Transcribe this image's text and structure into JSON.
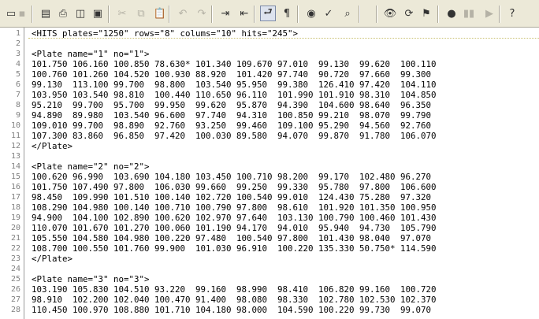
{
  "toolbar": {
    "buttons": [
      {
        "icon": "new-file-icon",
        "glyph": "▭",
        "disabled": false
      },
      {
        "icon": "save-icon",
        "glyph": "▪",
        "disabled": true
      },
      {
        "icon": "file-list-icon",
        "glyph": "▤",
        "disabled": false
      },
      {
        "icon": "print-icon",
        "glyph": "⎙",
        "disabled": false
      },
      {
        "icon": "print-preview-icon",
        "glyph": "◫",
        "disabled": false
      },
      {
        "icon": "page-setup-icon",
        "glyph": "▣",
        "disabled": false
      },
      {
        "icon": "cut-icon",
        "glyph": "✂",
        "disabled": true
      },
      {
        "icon": "copy-icon",
        "glyph": "⧉",
        "disabled": true
      },
      {
        "icon": "paste-icon",
        "glyph": "📋",
        "disabled": true
      },
      {
        "icon": "undo-icon",
        "glyph": "↶",
        "disabled": true
      },
      {
        "icon": "redo-icon",
        "glyph": "↷",
        "disabled": true
      },
      {
        "icon": "indent-icon",
        "glyph": "⇥",
        "disabled": false
      },
      {
        "icon": "outdent-icon",
        "glyph": "⇤",
        "disabled": false
      },
      {
        "icon": "word-wrap-icon",
        "glyph": "⮐",
        "disabled": false
      },
      {
        "icon": "pilcrow-icon",
        "glyph": "¶",
        "disabled": false
      },
      {
        "icon": "web-browser-icon",
        "glyph": "◉",
        "disabled": false
      },
      {
        "icon": "spell-check-icon",
        "glyph": "✓",
        "disabled": false
      },
      {
        "icon": "find-in-files-icon",
        "glyph": "⌕",
        "disabled": false
      },
      {
        "icon": "find-icon",
        "glyph": "👁",
        "disabled": false
      },
      {
        "icon": "replace-icon",
        "glyph": "⟳",
        "disabled": false
      },
      {
        "icon": "goto-icon",
        "glyph": "⚑",
        "disabled": false
      },
      {
        "icon": "toggle-bookmark-icon",
        "glyph": "●",
        "disabled": false
      },
      {
        "icon": "bookmark-navigation-icon",
        "glyph": "▮▮",
        "disabled": true
      },
      {
        "icon": "next-bookmark-icon",
        "glyph": "▶",
        "disabled": true
      },
      {
        "icon": "context-help-icon",
        "glyph": "?",
        "disabled": false
      }
    ]
  },
  "editor": {
    "lines": [
      {
        "n": "1",
        "text": "<HITS plates=\"1250\" rows=\"8\" colums=\"10\" hits=\"245\">"
      },
      {
        "n": "2",
        "text": ""
      },
      {
        "n": "3",
        "text": "<Plate name=\"1\" no=\"1\">"
      },
      {
        "n": "4",
        "text": "101.750 106.160 100.850 78.630* 101.340 109.670 97.010  99.130  99.620  100.110"
      },
      {
        "n": "5",
        "text": "100.760 101.260 104.520 100.930 88.920  101.420 97.740  90.720  97.660  99.300"
      },
      {
        "n": "6",
        "text": "99.130  113.100 99.700  98.800  103.540 95.950  99.380  126.410 97.420  104.110"
      },
      {
        "n": "7",
        "text": "103.950 103.540 98.810  100.440 110.650 96.110  101.990 101.910 98.310  104.850"
      },
      {
        "n": "8",
        "text": "95.210  99.700  95.700  99.950  99.620  95.870  94.390  104.600 98.640  96.350"
      },
      {
        "n": "9",
        "text": "94.890  89.980  103.540 96.600  97.740  94.310  100.850 99.210  98.070  99.790"
      },
      {
        "n": "10",
        "text": "109.010 99.700  98.890  92.760  93.250  99.460  109.100 95.290  94.560  92.760"
      },
      {
        "n": "11",
        "text": "107.300 83.860  96.850  97.420  100.030 89.580  94.070  99.870  91.780  106.070"
      },
      {
        "n": "12",
        "text": "</Plate>"
      },
      {
        "n": "13",
        "text": ""
      },
      {
        "n": "14",
        "text": "<Plate name=\"2\" no=\"2\">"
      },
      {
        "n": "15",
        "text": "100.620 96.990  103.690 104.180 103.450 100.710 98.200  99.170  102.480 96.270"
      },
      {
        "n": "16",
        "text": "101.750 107.490 97.800  106.030 99.660  99.250  99.330  95.780  97.800  106.600"
      },
      {
        "n": "17",
        "text": "98.450  109.990 101.510 100.140 102.720 100.540 99.010  124.430 75.280  97.320"
      },
      {
        "n": "18",
        "text": "108.290 104.980 100.140 100.710 100.790 97.800  98.610  101.920 101.350 100.950"
      },
      {
        "n": "19",
        "text": "94.900  104.100 102.890 100.620 102.970 97.640  103.130 100.790 100.460 101.430"
      },
      {
        "n": "20",
        "text": "110.070 101.670 101.270 100.060 101.190 94.170  94.010  95.940  94.730  105.790"
      },
      {
        "n": "21",
        "text": "105.550 104.580 104.980 100.220 97.480  100.540 97.800  101.430 98.040  97.070"
      },
      {
        "n": "22",
        "text": "108.700 100.550 101.760 99.900  101.030 96.910  100.220 135.330 50.750* 114.590"
      },
      {
        "n": "23",
        "text": "</Plate>"
      },
      {
        "n": "24",
        "text": ""
      },
      {
        "n": "25",
        "text": "<Plate name=\"3\" no=\"3\">"
      },
      {
        "n": "26",
        "text": "103.190 105.830 104.510 93.220  99.160  98.990  98.410  106.820 99.160  100.720"
      },
      {
        "n": "27",
        "text": "98.910  102.200 102.040 100.470 91.400  98.080  98.330  102.780 102.530 102.370"
      },
      {
        "n": "28",
        "text": "110.450 100.970 108.880 101.710 104.180 98.000  104.590 100.220 99.730  99.070"
      }
    ]
  }
}
